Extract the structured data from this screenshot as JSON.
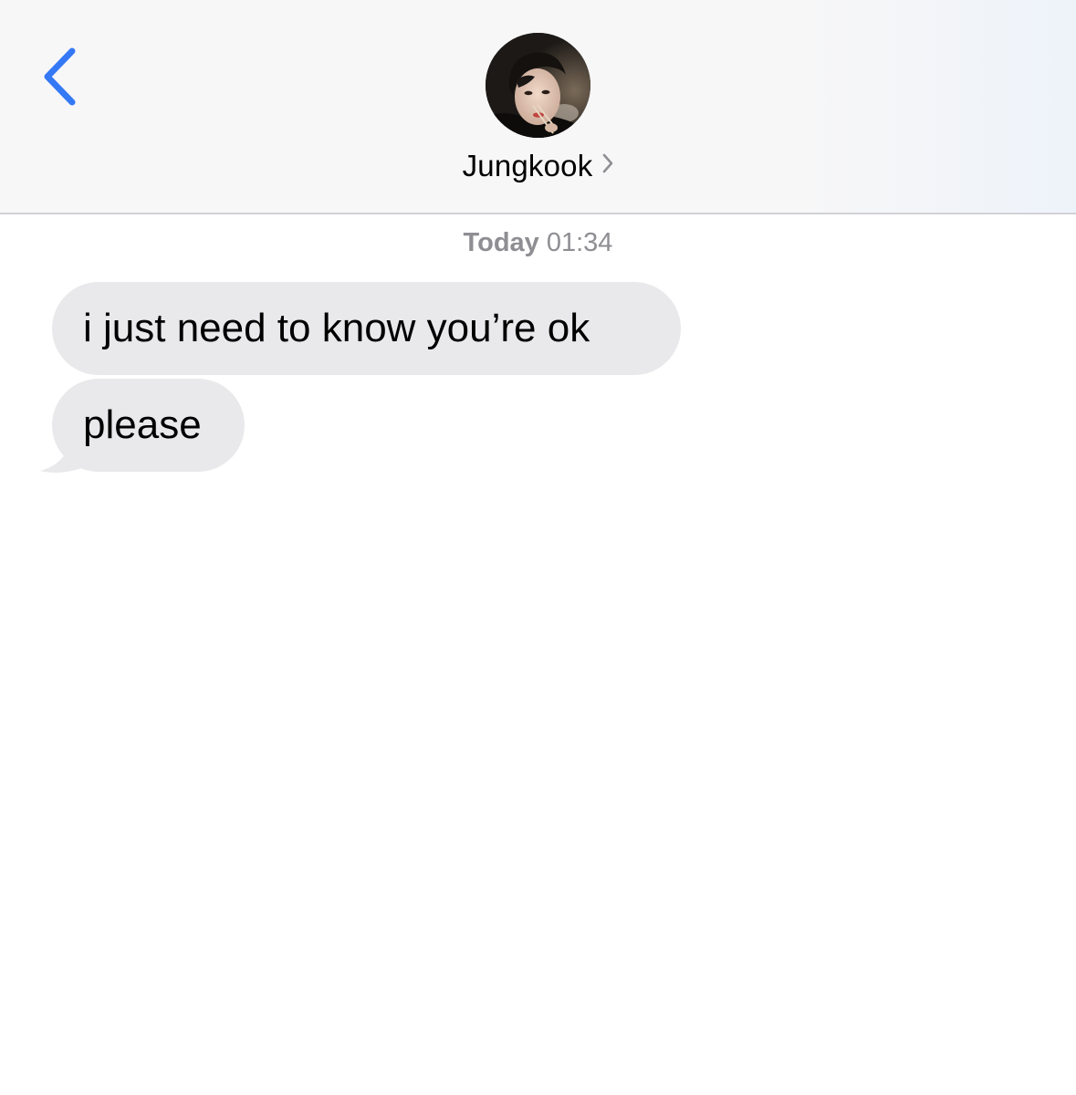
{
  "header": {
    "back_icon": "chevron-left-icon",
    "contact": {
      "name": "Jungkook",
      "avatar_icon": "contact-avatar-photo",
      "disclosure_icon": "chevron-right-icon"
    }
  },
  "conversation": {
    "timestamp": {
      "day": "Today",
      "time": "01:34"
    },
    "messages": [
      {
        "direction": "incoming",
        "text": "i just need to know you’re ok"
      },
      {
        "direction": "incoming",
        "text": "please"
      }
    ]
  },
  "colors": {
    "accent": "#3478f6",
    "incoming_bubble": "#e9e9eb",
    "timestamp_text": "#8e8e93",
    "nav_background": "#f7f7f8"
  }
}
